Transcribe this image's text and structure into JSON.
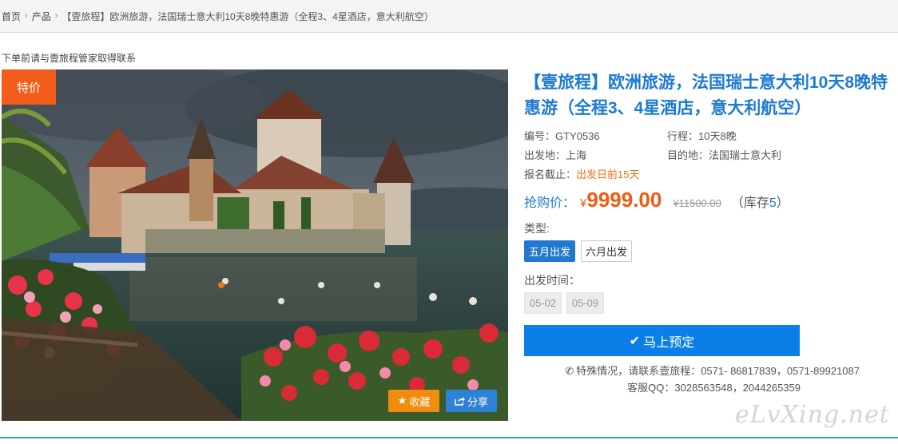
{
  "breadcrumb": {
    "home": "首页",
    "products": "产品",
    "current": "【壹旅程】欧洲旅游，法国瑞士意大利10天8晚特惠游（全程3、4星酒店，意大利航空）"
  },
  "notice": "下单前请与壹旅程管家取得联系",
  "photo": {
    "tag": "特价",
    "favorite_label": "收藏",
    "share_label": "分享",
    "favorite_icon": "star-icon",
    "share_icon": "share-icon"
  },
  "product": {
    "title": "【壹旅程】欧洲旅游，法国瑞士意大利10天8晚特惠游（全程3、4星酒店，意大利航空）",
    "code": "编号：GTY0536",
    "itinerary": "行程：10天8晚",
    "departure": "出发地：上海",
    "destination": "目的地：法国瑞士意大利",
    "deadline_label": "报名截止：",
    "deadline_value": "出发日前15天",
    "price_label": "抢购价：",
    "price_currency": "¥",
    "price": "9999.00",
    "original_price": "¥11500.00",
    "stock_open": "（库存",
    "stock_count": "5",
    "stock_close": "）",
    "type_label": "类型:",
    "types": [
      "五月出发",
      "六月出发"
    ],
    "selected_type": "五月出发",
    "depart_time_label": "出发时间：",
    "dates": [
      "05-02",
      "05-09"
    ],
    "book_label": "马上预定",
    "book_icon": "check-icon",
    "contact_line1": "特殊情况，请联系壹旅程：0571- 86817839，0571-89921087",
    "contact_line2": "客服QQ：3028563548，2044265359",
    "phone_icon": "phone-icon"
  },
  "watermark": "eLvXing.net",
  "colors": {
    "accent_blue": "#1d7ad1",
    "price_orange": "#f05a12",
    "tag_orange": "#f35d1b",
    "book_blue": "#0c7ee8"
  }
}
